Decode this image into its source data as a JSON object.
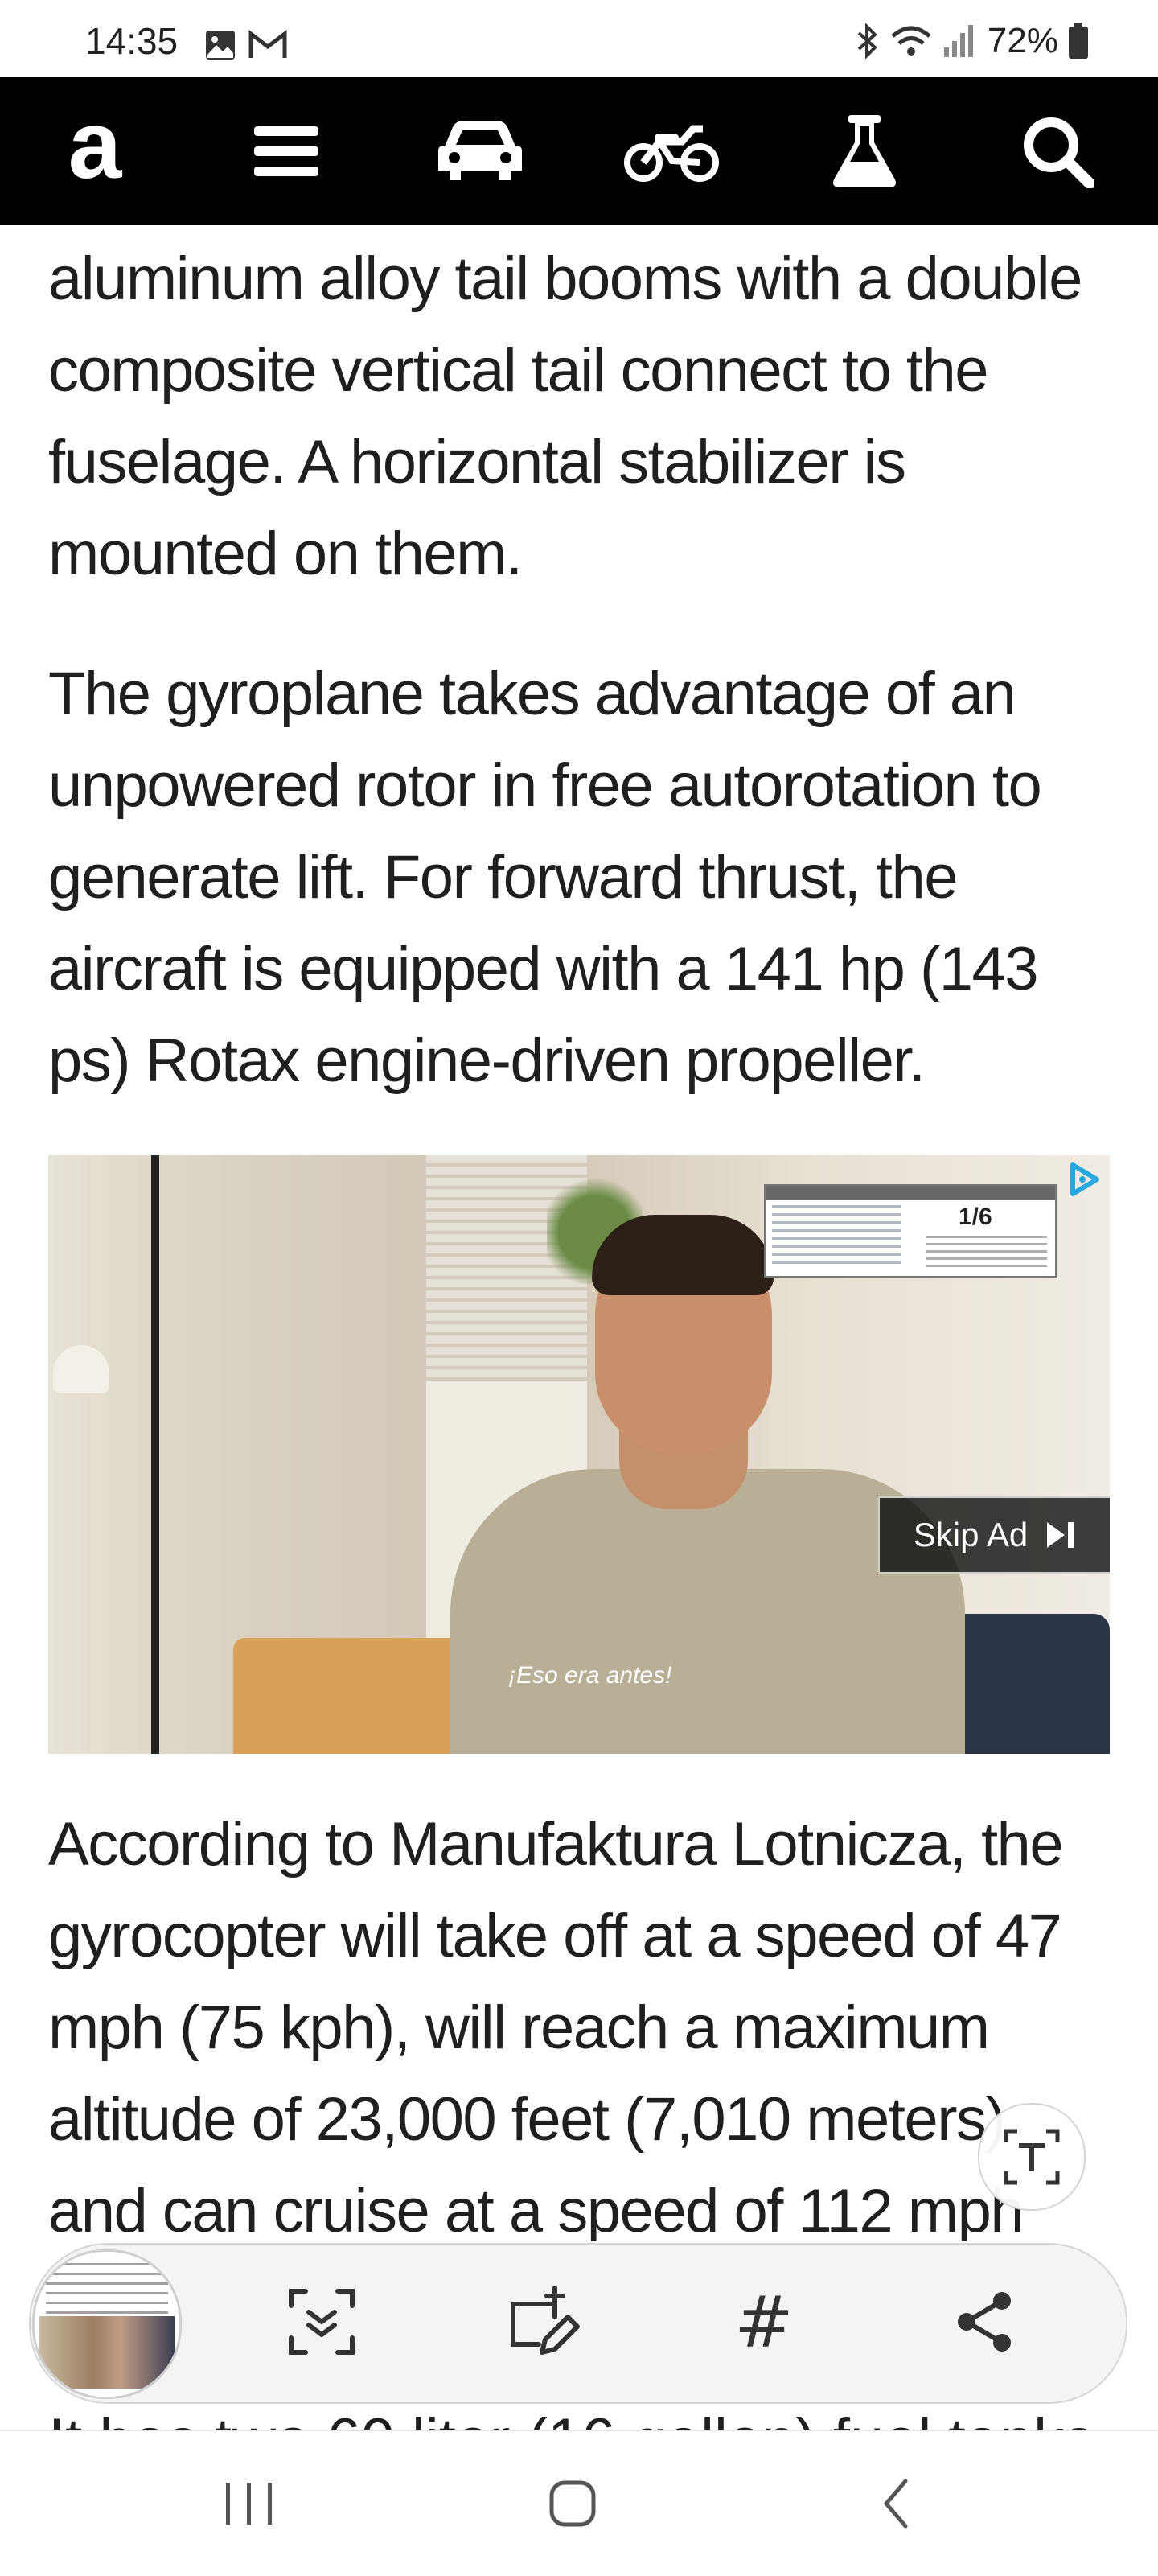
{
  "status_bar": {
    "time": "14:35",
    "battery": "72%"
  },
  "nav": {
    "logo": "a",
    "items": [
      "menu-icon",
      "car-icon",
      "motorcycle-icon",
      "flask-icon",
      "search-icon"
    ]
  },
  "article": {
    "paragraphs": [
      "aluminum alloy tail booms with a double composite vertical tail connect to the fuselage. A horizontal stabilizer is mounted on them.",
      "The gyroplane takes advantage of an unpowered rotor in free autorotation to generate lift. For forward thrust, the aircraft is equipped with a 141 hp (143 ps) Rotax engine-driven propeller.",
      "According to Manufaktura Lotnicza, the gyrocopter will take off at a speed of 47 mph (75 kph), will reach a maximum altitude of 23,000 feet (7,010 meters) and can cruise at a speed of 112 mph"
    ],
    "partial_next_line": "It has two 60 liter (16 gallon) fuel tanks"
  },
  "ad": {
    "info_number": "1/6",
    "skip_label": "Skip Ad",
    "subtitle": "¡Eso era antes!"
  },
  "toolbar": {
    "items": [
      "scan-icon",
      "edit-screenshot-icon",
      "hashtag-icon",
      "share-icon"
    ],
    "hash_glyph": "#"
  },
  "colors": {
    "nav_bg": "#000000",
    "text": "#1f1f1f",
    "ad_choices": "#29a8e0"
  }
}
